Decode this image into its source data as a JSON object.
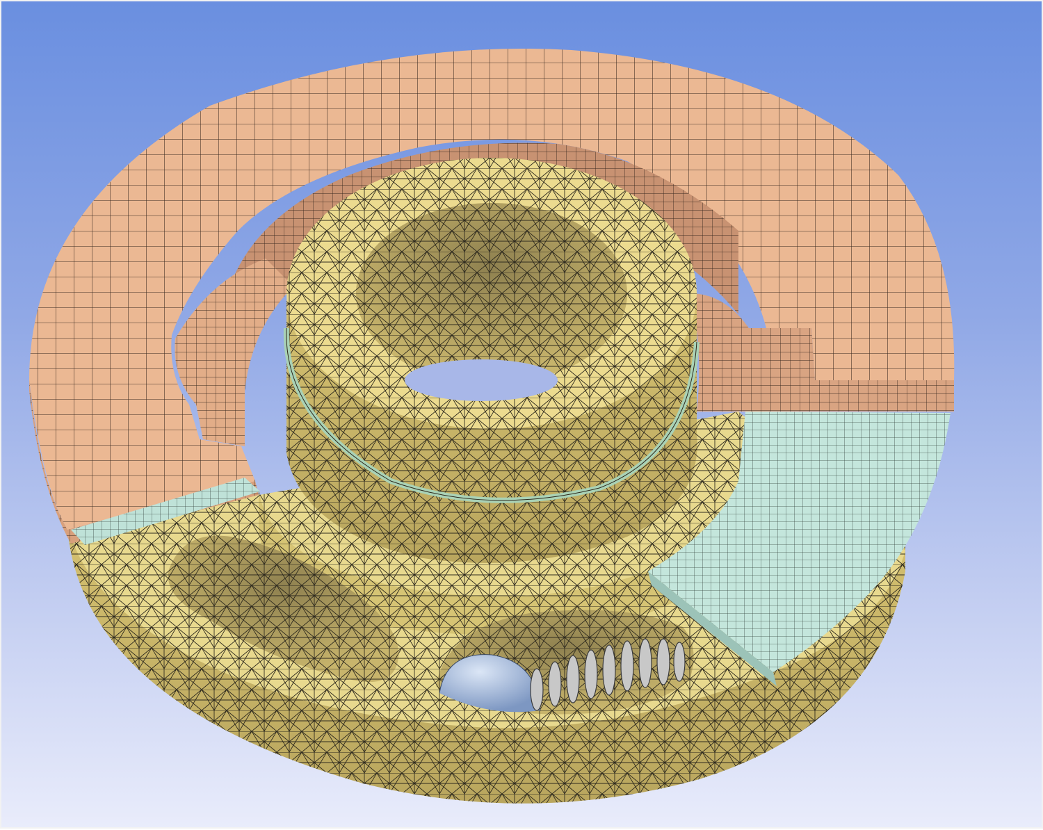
{
  "viewport": {
    "background_top": "#6a8fe0",
    "background_bottom": "#e9ecfb"
  },
  "parts": [
    {
      "name": "outer-housing",
      "color": "#e6b48f",
      "mesh": "quad"
    },
    {
      "name": "valve-body",
      "color": "#ead98a",
      "mesh": "tetra"
    },
    {
      "name": "seal-plate",
      "color": "#bfe2d8",
      "mesh": "quad"
    },
    {
      "name": "o-ring",
      "color": "#a9d2b6",
      "mesh": "quad"
    },
    {
      "name": "check-ball",
      "color": "#a8c0e0",
      "mesh": "tetra"
    },
    {
      "name": "spring",
      "color": "#b4b4b4",
      "mesh": "quad"
    }
  ],
  "mesh_line_color": "#2e2a1e"
}
